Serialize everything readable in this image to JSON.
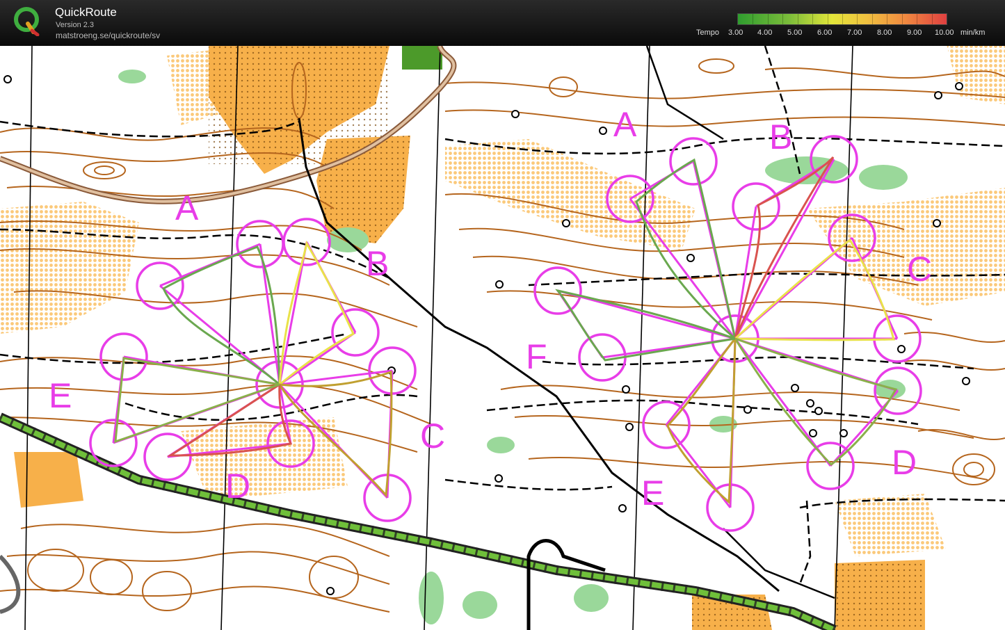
{
  "app": {
    "title": "QuickRoute",
    "version": "Version 2.3",
    "url": "matstroeng.se/quickroute/sv"
  },
  "pace_scale": {
    "label": "Tempo",
    "ticks": [
      "3.00",
      "4.00",
      "5.00",
      "6.00",
      "7.00",
      "8.00",
      "9.00",
      "10.00"
    ],
    "unit": "min/km",
    "colors": [
      "#2f9d2f",
      "#7dbd3a",
      "#e3e63a",
      "#f0c040",
      "#f08a40",
      "#e04040"
    ]
  },
  "map": {
    "colors": {
      "background": "#ffffff",
      "open_land": "#f7b04a",
      "rough_open": "#fbd7a0",
      "contour": "#b5651d",
      "green": "#8fd68f",
      "course": "#e83de8",
      "track": "#000000"
    },
    "left_butterfly": {
      "control_letters": [
        "A",
        "B",
        "C",
        "D",
        "E"
      ]
    },
    "right_butterfly": {
      "control_letters": [
        "A",
        "B",
        "C",
        "D",
        "E",
        "F"
      ]
    }
  }
}
